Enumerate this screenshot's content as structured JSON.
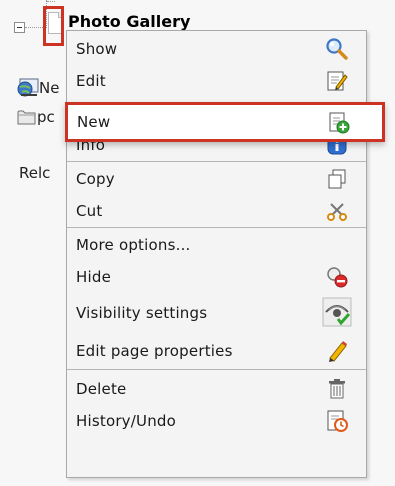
{
  "tree": {
    "node_title": "Photo Gallery",
    "bg_item_1": "Ne",
    "bg_item_2": "pc",
    "bg_item_3": "Relc"
  },
  "context_menu": {
    "items": [
      {
        "label": "Show",
        "icon": "magnifier-icon"
      },
      {
        "label": "Edit",
        "icon": "edit-page-icon"
      },
      {
        "label": "New",
        "icon": "new-page-icon"
      },
      {
        "label": "Info",
        "icon": "info-icon"
      },
      {
        "label": "Copy",
        "icon": "copy-icon"
      },
      {
        "label": "Cut",
        "icon": "scissors-icon"
      },
      {
        "label": "More options...",
        "icon": ""
      },
      {
        "label": "Hide",
        "icon": "hide-icon"
      },
      {
        "label": "Visibility settings",
        "icon": "visibility-eye-icon"
      },
      {
        "label": "Edit page properties",
        "icon": "pencil-icon"
      },
      {
        "label": "Delete",
        "icon": "trash-icon"
      },
      {
        "label": "History/Undo",
        "icon": "history-icon"
      }
    ]
  },
  "colors": {
    "highlight_border": "#cc3322",
    "menu_bg": "#f4f4f4",
    "separator": "#b6b6b6"
  }
}
